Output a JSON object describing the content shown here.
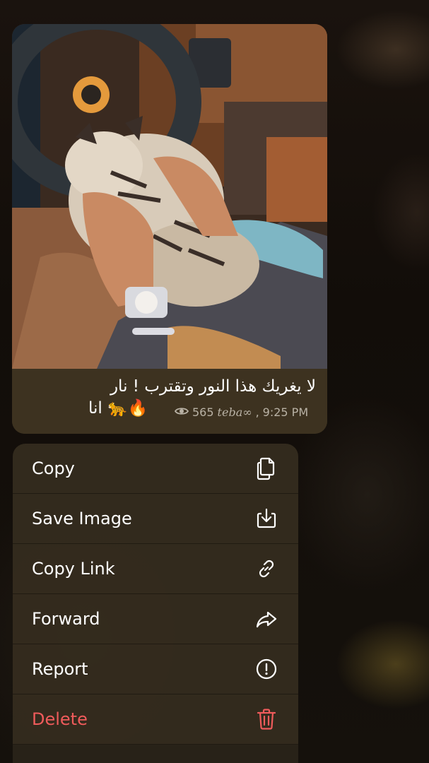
{
  "message": {
    "caption_line1": "لا يغريك هذا النور وتقترب ! نار",
    "caption_line2": "انا",
    "caption_emoji": "🔥🐆",
    "views": "565",
    "signature": "teba∞",
    "time": "9:25 PM"
  },
  "menu": {
    "items": [
      {
        "label": "Copy",
        "icon": "copy-icon"
      },
      {
        "label": "Save Image",
        "icon": "save-image-icon"
      },
      {
        "label": "Copy Link",
        "icon": "link-icon"
      },
      {
        "label": "Forward",
        "icon": "forward-icon"
      },
      {
        "label": "Report",
        "icon": "report-icon"
      },
      {
        "label": "Delete",
        "icon": "trash-icon"
      }
    ]
  },
  "colors": {
    "bubble_bg": "#3d3220",
    "menu_bg": "#342c1e",
    "destructive": "#ef5b5b",
    "meta_text": "#b9b2a5"
  }
}
